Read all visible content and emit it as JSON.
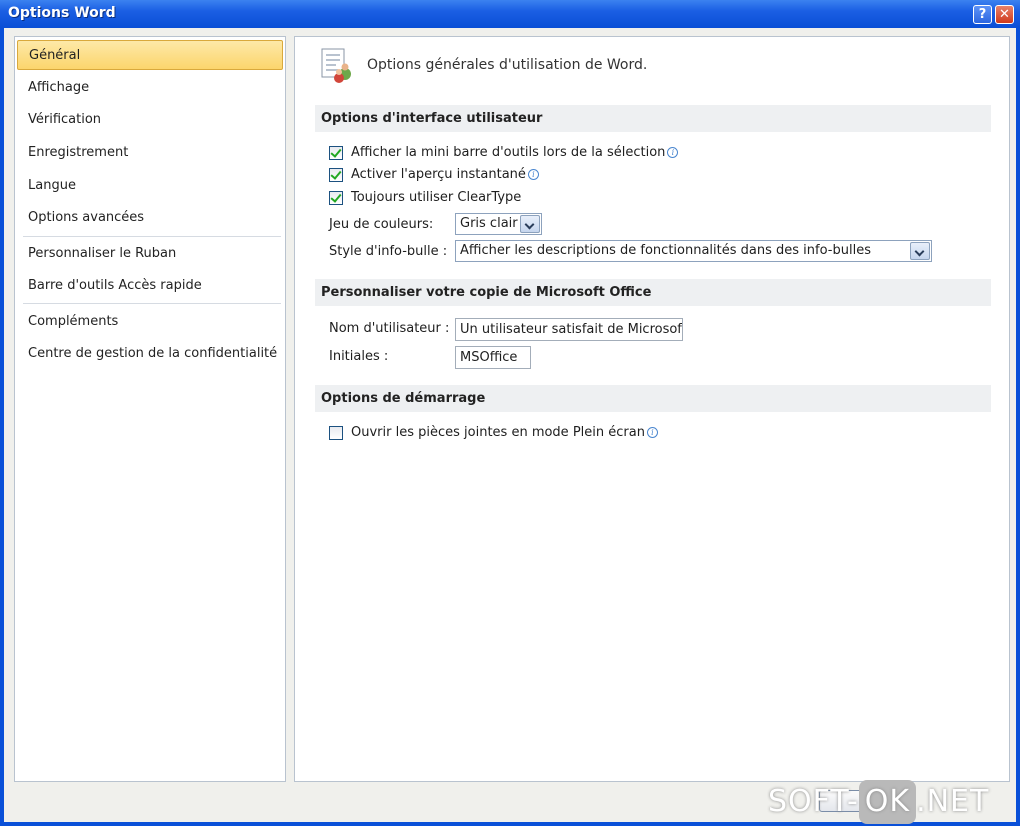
{
  "window": {
    "title": "Options Word",
    "help_label": "?",
    "close_label": "✕"
  },
  "nav": {
    "items": [
      {
        "label": "Général"
      },
      {
        "label": "Affichage"
      },
      {
        "label": "Vérification"
      },
      {
        "label": "Enregistrement"
      },
      {
        "label": "Langue"
      },
      {
        "label": "Options avancées"
      },
      {
        "label": "Personnaliser le Ruban"
      },
      {
        "label": "Barre d'outils Accès rapide"
      },
      {
        "label": "Compléments"
      },
      {
        "label": "Centre de gestion de la confidentialité"
      }
    ]
  },
  "content": {
    "header": "Options générales d'utilisation de Word.",
    "sections": {
      "ui": "Options d'interface utilisateur",
      "personalize": "Personnaliser votre copie de Microsoft Office",
      "startup": "Options de démarrage"
    },
    "ui_options": {
      "mini_toolbar": {
        "label": "Afficher la mini barre d'outils lors de la sélection",
        "checked": true
      },
      "live_preview": {
        "label": "Activer l'aperçu instantané",
        "checked": true
      },
      "cleartype": {
        "label": "Toujours utiliser ClearType",
        "checked": true
      },
      "color_scheme_label": "Jeu de couleurs:",
      "color_scheme_value": "Gris clair",
      "tooltip_style_label": "Style d'info-bulle :",
      "tooltip_style_value": "Afficher les descriptions de fonctionnalités dans des info-bulles"
    },
    "personalize": {
      "username_label": "Nom d'utilisateur :",
      "username_value": "Un utilisateur satisfait de Microsoft",
      "initials_label": "Initiales :",
      "initials_value": "MSOffice"
    },
    "startup": {
      "fullscreen": {
        "label": "Ouvrir les pièces jointes en mode Plein écran",
        "checked": false
      }
    },
    "info_glyph": "i"
  },
  "watermark": {
    "prefix": "SOFT-",
    "middle": "OK",
    "suffix": ".NET"
  }
}
